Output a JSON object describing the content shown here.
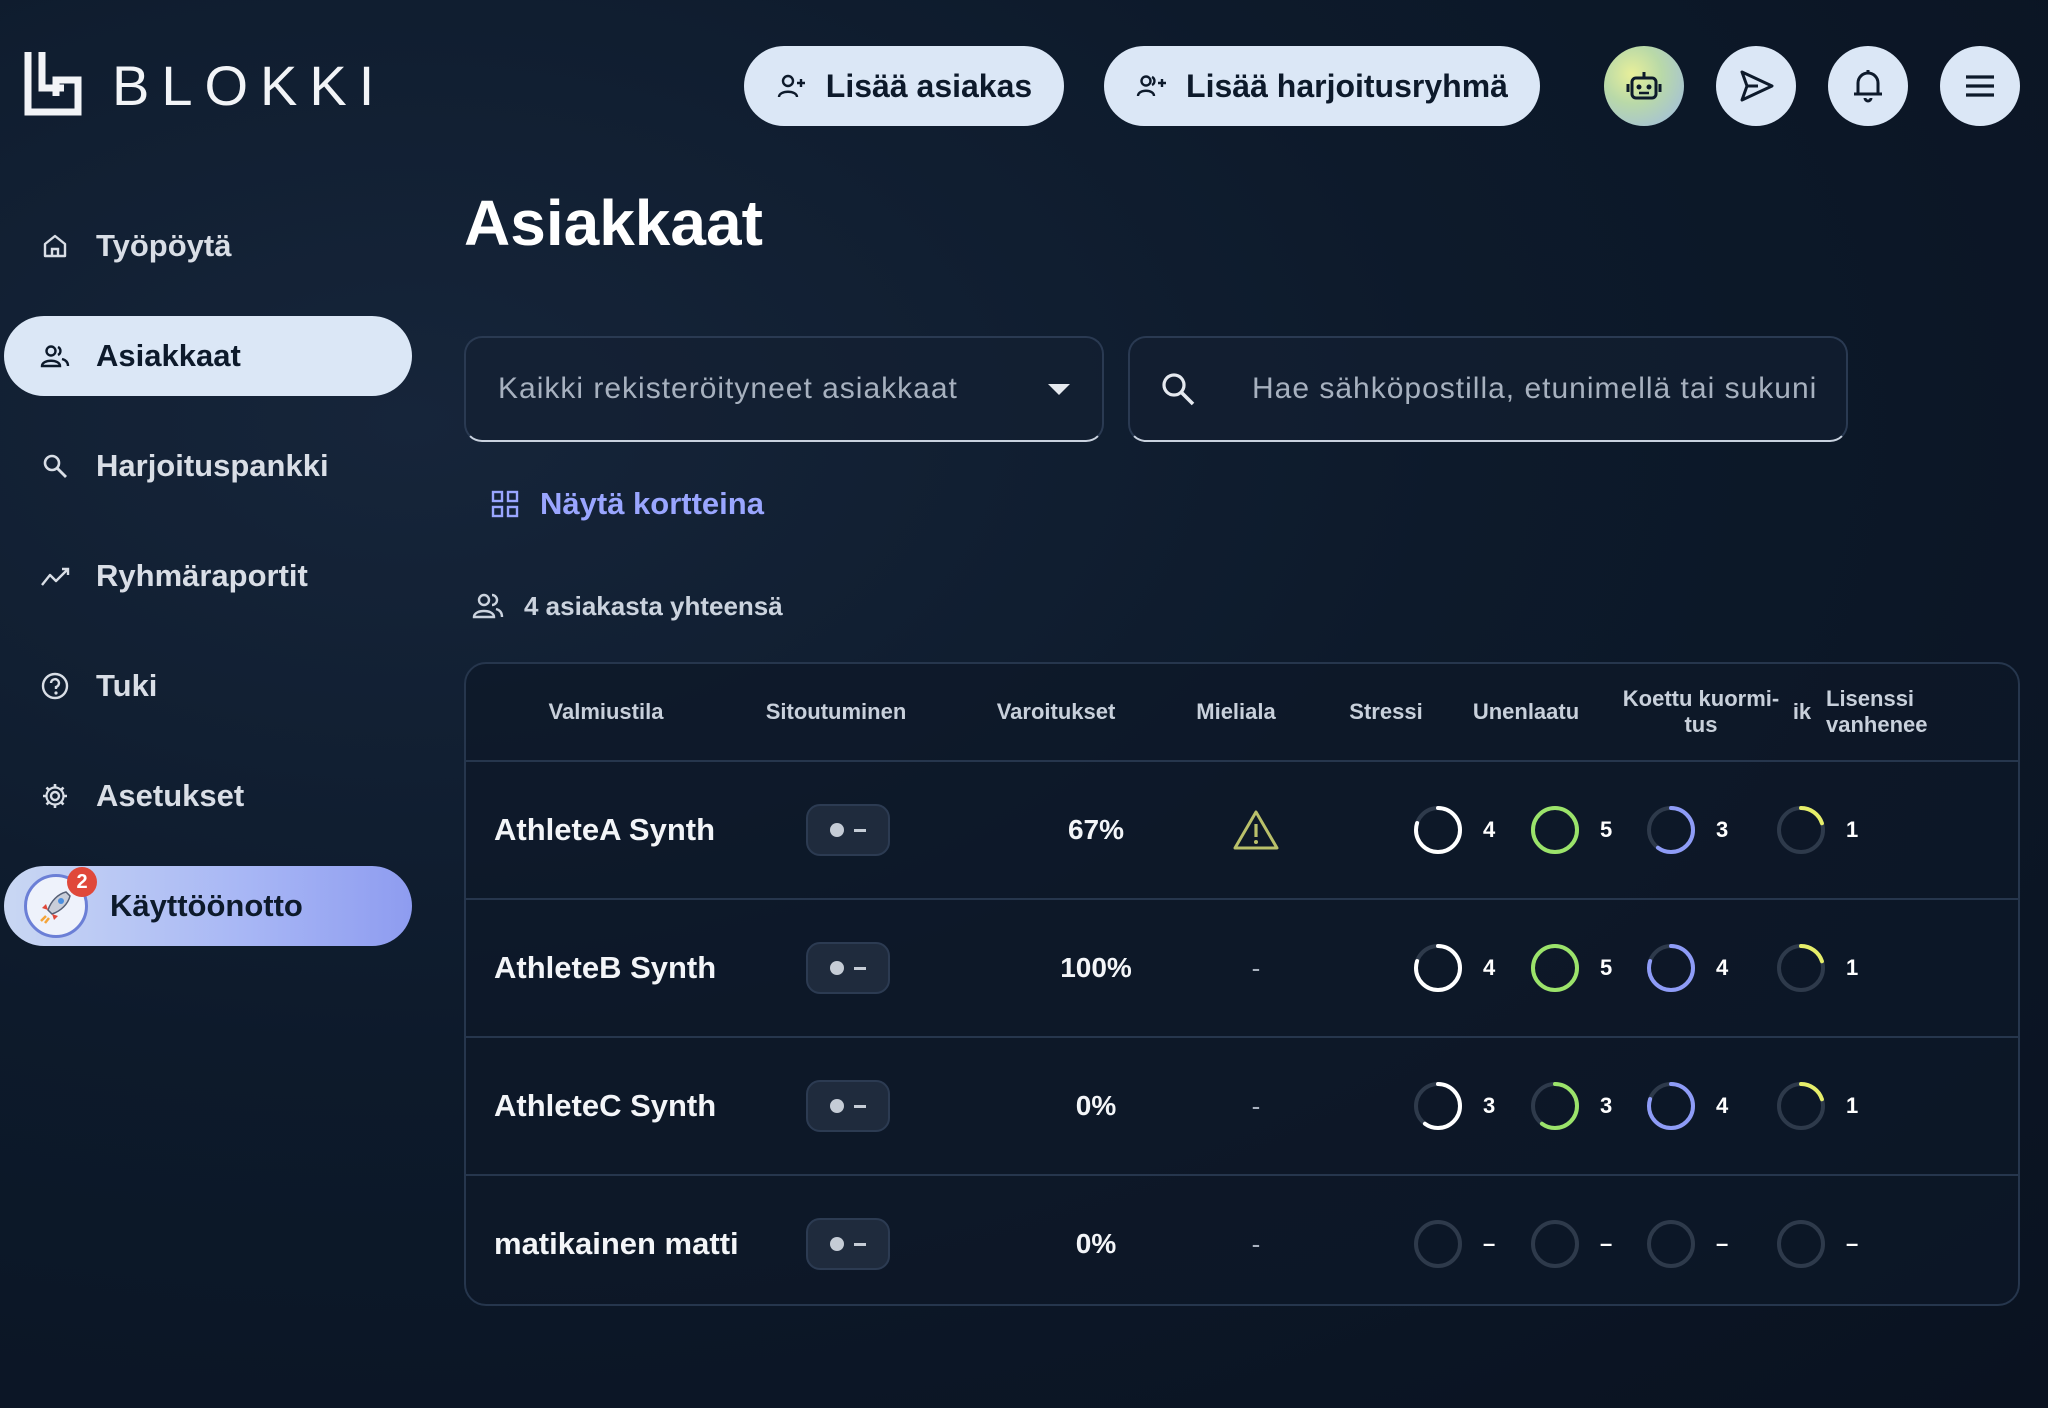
{
  "brand": {
    "name": "BLOKKI"
  },
  "header": {
    "add_client": "Lisää asiakas",
    "add_group": "Lisää harjoitusryhmä"
  },
  "sidebar": {
    "items": [
      {
        "label": "Työpöytä",
        "icon": "home-icon"
      },
      {
        "label": "Asiakkaat",
        "icon": "users-icon",
        "active": true
      },
      {
        "label": "Harjoituspankki",
        "icon": "search-icon"
      },
      {
        "label": "Ryhmäraportit",
        "icon": "trend-icon"
      },
      {
        "label": "Tuki",
        "icon": "help-icon"
      },
      {
        "label": "Asetukset",
        "icon": "gear-icon"
      }
    ],
    "onboarding": {
      "label": "Käyttöönotto",
      "badge": "2",
      "icon": "rocket-icon"
    }
  },
  "main": {
    "title": "Asiakkaat",
    "filter": {
      "value": "Kaikki rekisteröityneet asiakkaat"
    },
    "search": {
      "placeholder": "Hae sähköpostilla, etunimellä tai sukunimellä"
    },
    "view_toggle": "Näytä kortteina",
    "total": "4 asiakasta yhteensä"
  },
  "table": {
    "headers": {
      "readiness": "Valmiustila",
      "engagement": "Sitoutuminen",
      "warnings": "Varoitukset",
      "mood": "Mieliala",
      "stress": "Stressi",
      "sleep": "Unenlaatu",
      "load": "Koettu kuormi-\ntus",
      "extra": "ik",
      "license": "Lisenssi\nvanhenee"
    },
    "colors": {
      "stress": "#ffffff",
      "sleep": "#9be36a",
      "load": "#8e9cf7",
      "license": "#e6ee6a",
      "empty": "#2e3a4b"
    },
    "rows": [
      {
        "name": "AthleteA Synth",
        "warnings": "67%",
        "mood": "warning-icon",
        "mood_text": "",
        "stress": {
          "value": "4",
          "fill": 0.8
        },
        "sleep": {
          "value": "5",
          "fill": 1.0
        },
        "load": {
          "value": "3",
          "fill": 0.6
        },
        "license": {
          "value": "1",
          "fill": 0.2
        }
      },
      {
        "name": "AthleteB Synth",
        "warnings": "100%",
        "mood": "",
        "mood_text": "-",
        "stress": {
          "value": "4",
          "fill": 0.8
        },
        "sleep": {
          "value": "5",
          "fill": 1.0
        },
        "load": {
          "value": "4",
          "fill": 0.8
        },
        "license": {
          "value": "1",
          "fill": 0.2
        }
      },
      {
        "name": "AthleteC Synth",
        "warnings": "0%",
        "mood": "",
        "mood_text": "-",
        "stress": {
          "value": "3",
          "fill": 0.6
        },
        "sleep": {
          "value": "3",
          "fill": 0.6
        },
        "load": {
          "value": "4",
          "fill": 0.8
        },
        "license": {
          "value": "1",
          "fill": 0.2
        }
      },
      {
        "name": "matikainen matti",
        "warnings": "0%",
        "mood": "",
        "mood_text": "-",
        "stress": {
          "value": "–",
          "fill": 0
        },
        "sleep": {
          "value": "–",
          "fill": 0
        },
        "load": {
          "value": "–",
          "fill": 0
        },
        "license": {
          "value": "–",
          "fill": 0
        }
      }
    ]
  }
}
